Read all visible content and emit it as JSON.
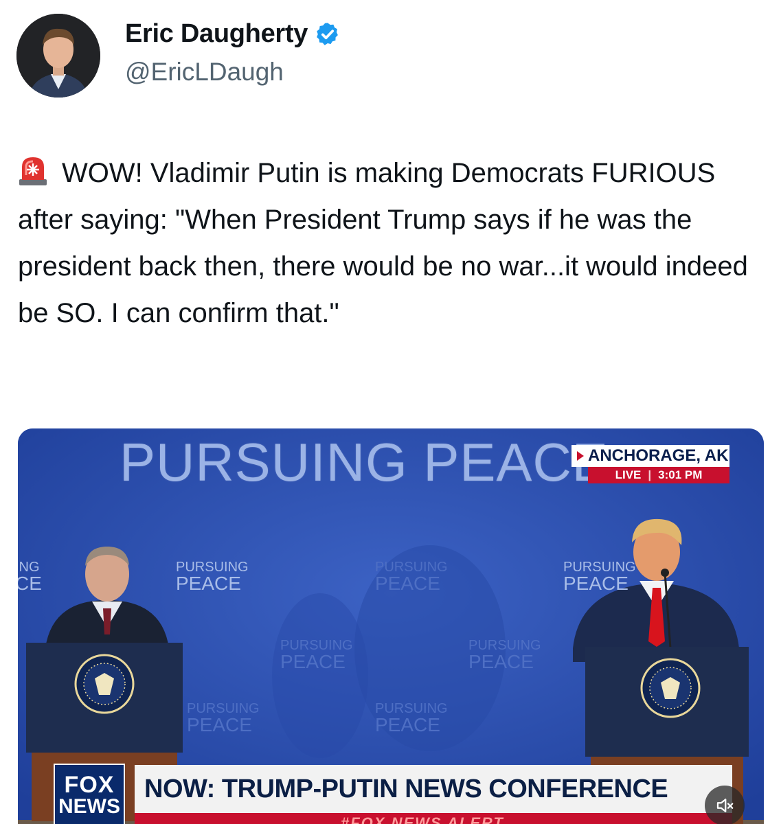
{
  "author": {
    "display_name": "Eric Daugherty",
    "handle": "@EricLDaugh",
    "verified": true,
    "verified_color": "#1d9bf0",
    "avatar_icon": "profile-photo"
  },
  "tweet": {
    "emoji_icon": "police-car-light-icon",
    "text": "WOW! Vladimir Putin is making Democrats FURIOUS after saying: \"When President Trump says if he was the president back then, there would be no war...it would indeed be SO. I can confirm that.\""
  },
  "media": {
    "banner_title": "PURSUING PEACE",
    "backdrop_logos": [
      {
        "line1": "PURSUING",
        "line2": "PEACE"
      },
      {
        "line1": "PURSUING",
        "line2": "PEACE"
      },
      {
        "line1": "PURSUING",
        "line2": "PEACE"
      },
      {
        "line1": "PURSUING",
        "line2": "PEACE"
      },
      {
        "line1": "PURSUING",
        "line2": "PEACE"
      },
      {
        "line1": "PURSUING",
        "line2": "PEACE"
      },
      {
        "line1": "PURSUING",
        "line2": "PEACE"
      }
    ],
    "edge_left": {
      "line1": "ING",
      "line2": "CE"
    },
    "location": "ANCHORAGE, AK",
    "live_label": "LIVE",
    "live_time": "3:01 PM",
    "network_logo": {
      "line1": "FOX",
      "line2": "NEWS"
    },
    "chyron": "NOW: TRUMP-PUTIN NEWS CONFERENCE",
    "alert_strip": "#FOX NEWS ALERT",
    "mute_icon": "speaker-muted-icon",
    "colors": {
      "backdrop": "#2c50b0",
      "alert_red": "#c8102e",
      "chyron_navy": "#0b1f45"
    }
  }
}
